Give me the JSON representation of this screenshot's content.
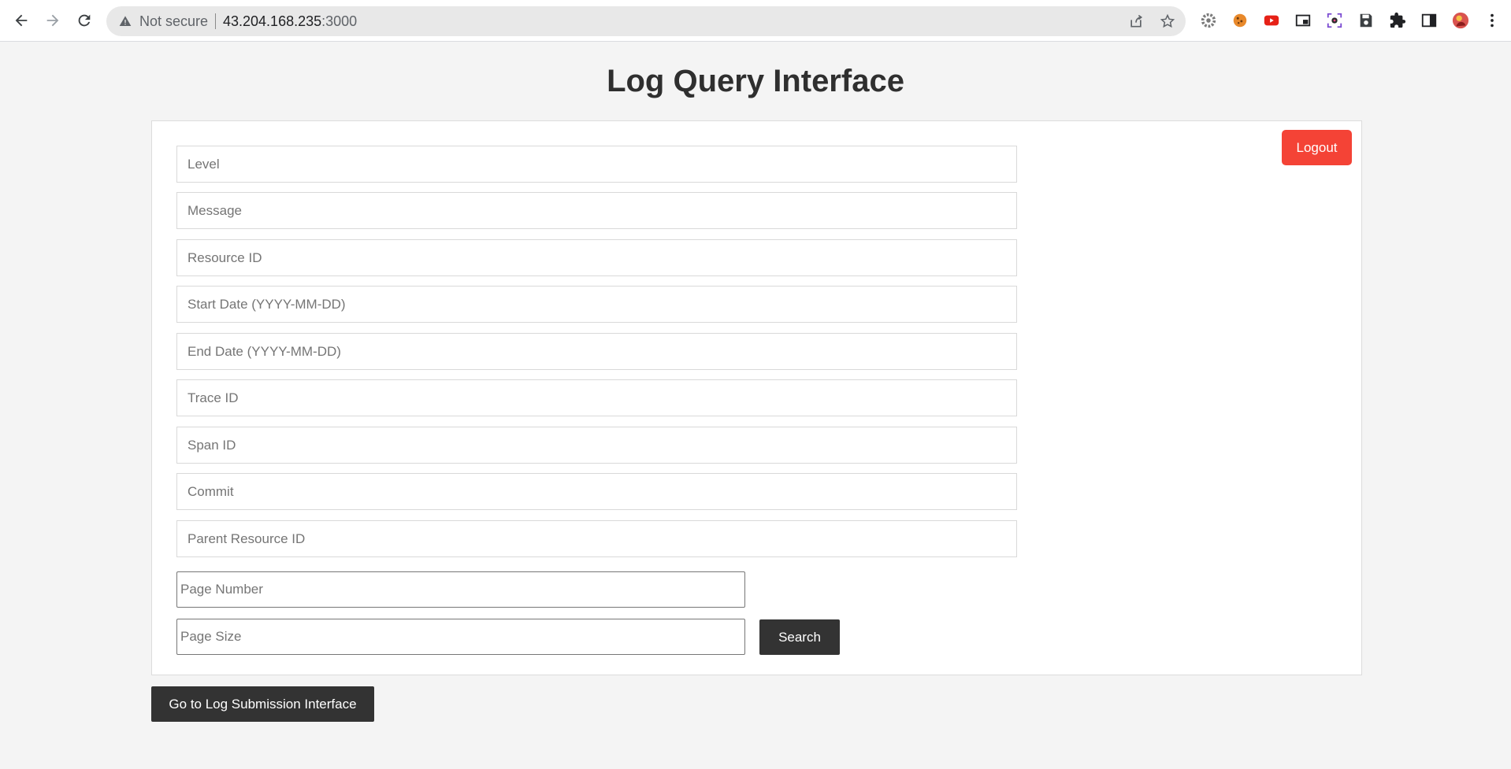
{
  "browser": {
    "security_status": "Not secure",
    "url_host": "43.204.168.235",
    "url_port": ":3000",
    "nav": {
      "back_icon": "arrow-left-icon",
      "forward_icon": "arrow-right-icon",
      "reload_icon": "reload-icon"
    },
    "extensions": [
      "gear-extension-icon",
      "cookie-extension-icon",
      "youtube-extension-icon",
      "picture-in-picture-icon",
      "screen-capture-icon",
      "save-extension-icon",
      "puzzle-extensions-icon",
      "side-panel-icon",
      "profile-avatar",
      "more-menu-icon"
    ]
  },
  "page": {
    "title": "Log Query Interface",
    "logout_label": "Logout",
    "fields": [
      {
        "key": "level",
        "placeholder": "Level",
        "value": ""
      },
      {
        "key": "message",
        "placeholder": "Message",
        "value": ""
      },
      {
        "key": "resource-id",
        "placeholder": "Resource ID",
        "value": ""
      },
      {
        "key": "start-date",
        "placeholder": "Start Date (YYYY-MM-DD)",
        "value": ""
      },
      {
        "key": "end-date",
        "placeholder": "End Date (YYYY-MM-DD)",
        "value": ""
      },
      {
        "key": "trace-id",
        "placeholder": "Trace ID",
        "value": ""
      },
      {
        "key": "span-id",
        "placeholder": "Span ID",
        "value": ""
      },
      {
        "key": "commit",
        "placeholder": "Commit",
        "value": ""
      },
      {
        "key": "parent-resource-id",
        "placeholder": "Parent Resource ID",
        "value": ""
      }
    ],
    "page_number": {
      "placeholder": "Page Number",
      "value": ""
    },
    "page_size": {
      "placeholder": "Page Size",
      "value": ""
    },
    "search_label": "Search",
    "goto_label": "Go to Log Submission Interface",
    "colors": {
      "background": "#f4f4f4",
      "panel": "#ffffff",
      "logout": "#f44336",
      "dark_button": "#333333"
    }
  }
}
